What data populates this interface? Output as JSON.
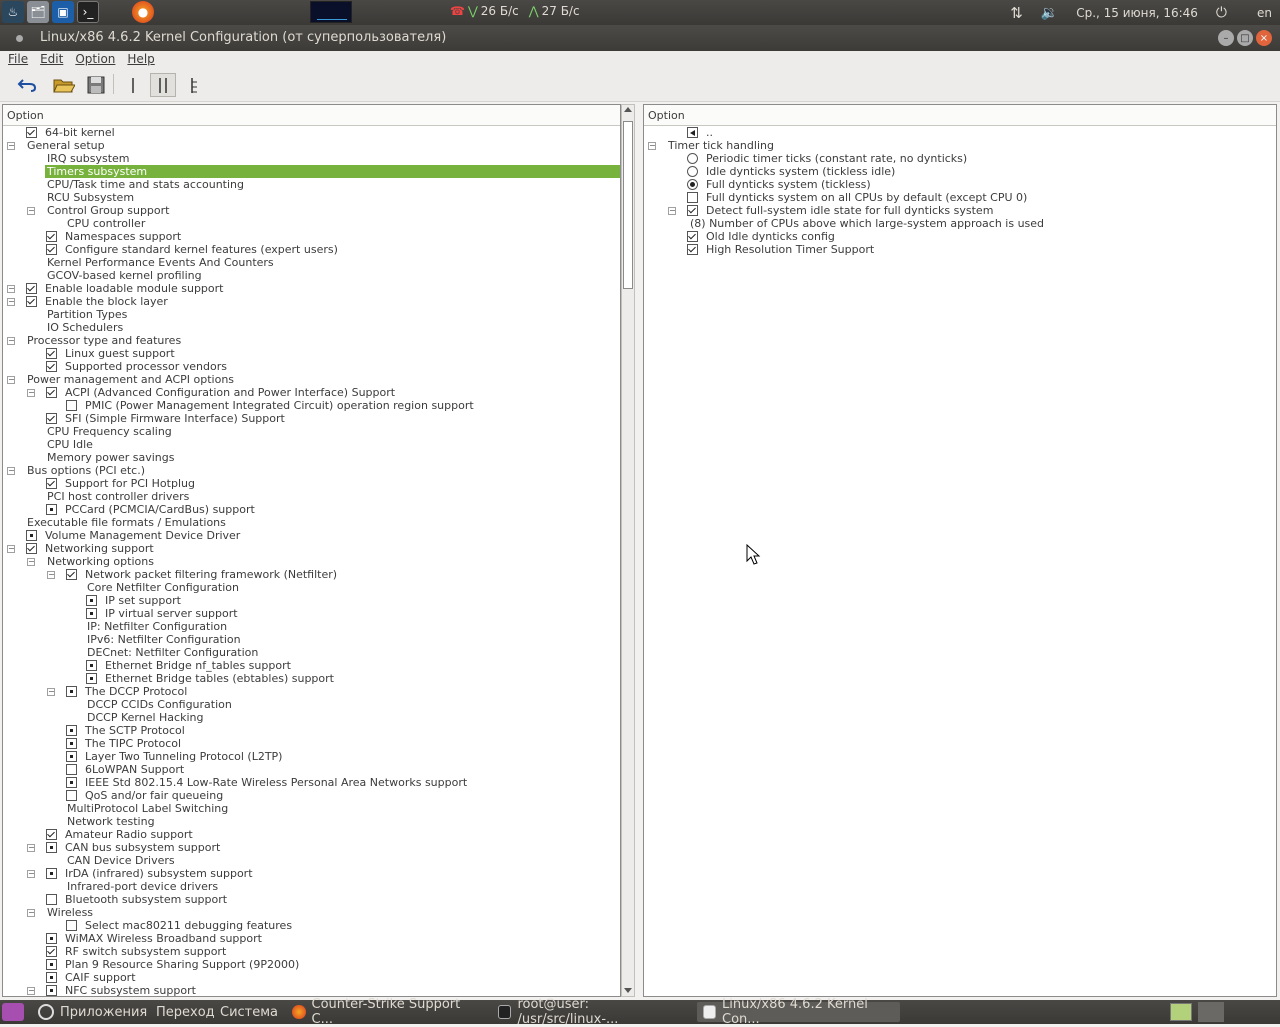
{
  "topbar": {
    "net_down": "26 Б/с",
    "net_up": "27 Б/с",
    "datetime": "Ср., 15 июня, 16:46",
    "lang": "en"
  },
  "window": {
    "title": "Linux/x86 4.6.2 Kernel Configuration (от суперпользователя)"
  },
  "menu": [
    "File",
    "Edit",
    "Option",
    "Help"
  ],
  "left_pane": {
    "header": "Option",
    "rows": [
      {
        "d": 0,
        "exp": "",
        "chk": "on",
        "t": "64-bit kernel"
      },
      {
        "d": 0,
        "exp": "-",
        "chk": "",
        "t": "General setup"
      },
      {
        "d": 1,
        "exp": "",
        "chk": "",
        "t": "IRQ subsystem"
      },
      {
        "d": 1,
        "exp": "",
        "chk": "",
        "t": "Timers subsystem",
        "sel": true
      },
      {
        "d": 1,
        "exp": "",
        "chk": "",
        "t": "CPU/Task time and stats accounting"
      },
      {
        "d": 1,
        "exp": "",
        "chk": "",
        "t": "RCU Subsystem"
      },
      {
        "d": 1,
        "exp": "-",
        "chk": "",
        "t": "Control Group support"
      },
      {
        "d": 2,
        "exp": "",
        "chk": "",
        "t": "CPU controller"
      },
      {
        "d": 1,
        "exp": "",
        "chk": "on",
        "t": "Namespaces support"
      },
      {
        "d": 1,
        "exp": "",
        "chk": "on",
        "t": "Configure standard kernel features (expert users)"
      },
      {
        "d": 1,
        "exp": "",
        "chk": "",
        "t": "Kernel Performance Events And Counters"
      },
      {
        "d": 1,
        "exp": "",
        "chk": "",
        "t": "GCOV-based kernel profiling"
      },
      {
        "d": 0,
        "exp": "-",
        "chk": "on",
        "t": "Enable loadable module support"
      },
      {
        "d": 0,
        "exp": "-",
        "chk": "on",
        "t": "Enable the block layer"
      },
      {
        "d": 1,
        "exp": "",
        "chk": "",
        "t": "Partition Types"
      },
      {
        "d": 1,
        "exp": "",
        "chk": "",
        "t": "IO Schedulers"
      },
      {
        "d": 0,
        "exp": "-",
        "chk": "",
        "t": "Processor type and features"
      },
      {
        "d": 1,
        "exp": "",
        "chk": "on",
        "t": "Linux guest support"
      },
      {
        "d": 1,
        "exp": "",
        "chk": "on",
        "t": "Supported processor vendors"
      },
      {
        "d": 0,
        "exp": "-",
        "chk": "",
        "t": "Power management and ACPI options"
      },
      {
        "d": 1,
        "exp": "-",
        "chk": "on",
        "t": "ACPI (Advanced Configuration and Power Interface) Support"
      },
      {
        "d": 2,
        "exp": "",
        "chk": "off",
        "t": "PMIC (Power Management Integrated Circuit) operation region support"
      },
      {
        "d": 1,
        "exp": "",
        "chk": "on",
        "t": "SFI (Simple Firmware Interface) Support"
      },
      {
        "d": 1,
        "exp": "",
        "chk": "",
        "t": "CPU Frequency scaling"
      },
      {
        "d": 1,
        "exp": "",
        "chk": "",
        "t": "CPU Idle"
      },
      {
        "d": 1,
        "exp": "",
        "chk": "",
        "t": "Memory power savings"
      },
      {
        "d": 0,
        "exp": "-",
        "chk": "",
        "t": "Bus options (PCI etc.)"
      },
      {
        "d": 1,
        "exp": "",
        "chk": "on",
        "t": "Support for PCI Hotplug"
      },
      {
        "d": 1,
        "exp": "",
        "chk": "",
        "t": "PCI host controller drivers"
      },
      {
        "d": 1,
        "exp": "",
        "chk": "mod",
        "t": "PCCard (PCMCIA/CardBus) support"
      },
      {
        "d": 0,
        "exp": "",
        "chk": "",
        "t": "Executable file formats / Emulations"
      },
      {
        "d": 0,
        "exp": "",
        "chk": "mod",
        "t": "Volume Management Device Driver"
      },
      {
        "d": 0,
        "exp": "-",
        "chk": "on",
        "t": "Networking support"
      },
      {
        "d": 1,
        "exp": "-",
        "chk": "",
        "t": "Networking options"
      },
      {
        "d": 2,
        "exp": "-",
        "chk": "on",
        "t": "Network packet filtering framework (Netfilter)"
      },
      {
        "d": 3,
        "exp": "",
        "chk": "",
        "t": "Core Netfilter Configuration"
      },
      {
        "d": 3,
        "exp": "",
        "chk": "mod",
        "t": "IP set support"
      },
      {
        "d": 3,
        "exp": "",
        "chk": "mod",
        "t": "IP virtual server support"
      },
      {
        "d": 3,
        "exp": "",
        "chk": "",
        "t": "IP: Netfilter Configuration"
      },
      {
        "d": 3,
        "exp": "",
        "chk": "",
        "t": "IPv6: Netfilter Configuration"
      },
      {
        "d": 3,
        "exp": "",
        "chk": "",
        "t": "DECnet: Netfilter Configuration"
      },
      {
        "d": 3,
        "exp": "",
        "chk": "mod",
        "t": "Ethernet Bridge nf_tables support"
      },
      {
        "d": 3,
        "exp": "",
        "chk": "mod",
        "t": "Ethernet Bridge tables (ebtables) support"
      },
      {
        "d": 2,
        "exp": "-",
        "chk": "mod",
        "t": "The DCCP Protocol"
      },
      {
        "d": 3,
        "exp": "",
        "chk": "",
        "t": "DCCP CCIDs Configuration"
      },
      {
        "d": 3,
        "exp": "",
        "chk": "",
        "t": "DCCP Kernel Hacking"
      },
      {
        "d": 2,
        "exp": "",
        "chk": "mod",
        "t": "The SCTP Protocol"
      },
      {
        "d": 2,
        "exp": "",
        "chk": "mod",
        "t": "The TIPC Protocol"
      },
      {
        "d": 2,
        "exp": "",
        "chk": "mod",
        "t": "Layer Two Tunneling Protocol (L2TP)"
      },
      {
        "d": 2,
        "exp": "",
        "chk": "off",
        "t": "6LoWPAN Support"
      },
      {
        "d": 2,
        "exp": "",
        "chk": "mod",
        "t": "IEEE Std 802.15.4 Low-Rate Wireless Personal Area Networks support"
      },
      {
        "d": 2,
        "exp": "",
        "chk": "off",
        "t": "QoS and/or fair queueing"
      },
      {
        "d": 2,
        "exp": "",
        "chk": "",
        "t": "MultiProtocol Label Switching"
      },
      {
        "d": 2,
        "exp": "",
        "chk": "",
        "t": "Network testing"
      },
      {
        "d": 1,
        "exp": "",
        "chk": "on",
        "t": "Amateur Radio support"
      },
      {
        "d": 1,
        "exp": "-",
        "chk": "mod",
        "t": "CAN bus subsystem support"
      },
      {
        "d": 2,
        "exp": "",
        "chk": "",
        "t": "CAN Device Drivers"
      },
      {
        "d": 1,
        "exp": "-",
        "chk": "mod",
        "t": "IrDA (infrared) subsystem support"
      },
      {
        "d": 2,
        "exp": "",
        "chk": "",
        "t": "Infrared-port device drivers"
      },
      {
        "d": 1,
        "exp": "",
        "chk": "off",
        "t": "Bluetooth subsystem support"
      },
      {
        "d": 1,
        "exp": "-",
        "chk": "",
        "t": "Wireless"
      },
      {
        "d": 2,
        "exp": "",
        "chk": "off",
        "t": "Select mac80211 debugging features"
      },
      {
        "d": 1,
        "exp": "",
        "chk": "mod",
        "t": "WiMAX Wireless Broadband support"
      },
      {
        "d": 1,
        "exp": "",
        "chk": "on",
        "t": "RF switch subsystem support"
      },
      {
        "d": 1,
        "exp": "",
        "chk": "mod",
        "t": "Plan 9 Resource Sharing Support (9P2000)"
      },
      {
        "d": 1,
        "exp": "",
        "chk": "mod",
        "t": "CAIF support"
      },
      {
        "d": 1,
        "exp": "-",
        "chk": "mod",
        "t": "NFC subsystem support"
      }
    ]
  },
  "right_pane": {
    "header": "Option",
    "rows": [
      {
        "d": 1,
        "exp": "",
        "chk": "arr",
        "t": ".."
      },
      {
        "d": 0,
        "exp": "-",
        "chk": "",
        "t": "Timer tick handling"
      },
      {
        "d": 1,
        "exp": "",
        "rad": "off",
        "t": "Periodic timer ticks (constant rate, no dynticks)"
      },
      {
        "d": 1,
        "exp": "",
        "rad": "off",
        "t": "Idle dynticks system (tickless idle)"
      },
      {
        "d": 1,
        "exp": "",
        "rad": "on",
        "t": "Full dynticks system (tickless)"
      },
      {
        "d": 1,
        "exp": "",
        "chk": "off",
        "t": "Full dynticks system on all CPUs by default (except CPU 0)"
      },
      {
        "d": 1,
        "exp": "-",
        "chk": "on",
        "t": "Detect full-system idle state for full dynticks system"
      },
      {
        "d": 1,
        "exp": "",
        "chk": "",
        "t": "(8) Number of CPUs above which large-system approach is used",
        "indent": true
      },
      {
        "d": 1,
        "exp": "",
        "chk": "on",
        "t": "Old Idle dynticks config"
      },
      {
        "d": 1,
        "exp": "",
        "chk": "on",
        "t": "High Resolution Timer Support"
      }
    ]
  },
  "taskbar": {
    "apps": "Приложения",
    "places": "Переход",
    "system": "Система",
    "tasks": [
      "Counter-Strike Support C...",
      "root@user: /usr/src/linux-...",
      "Linux/x86 4.6.2 Kernel Con..."
    ]
  }
}
